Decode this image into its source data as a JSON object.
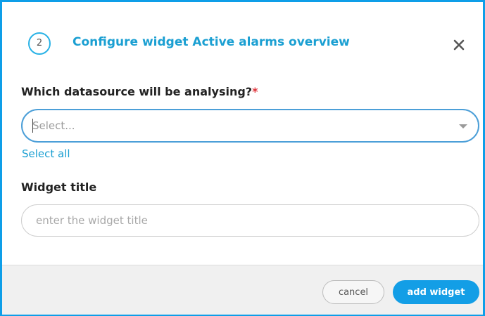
{
  "dialog": {
    "step_number": "2",
    "title": "Configure widget Active alarms overview",
    "close_icon": "close-icon"
  },
  "datasource": {
    "label": "Which datasource will be analysing?",
    "required_marker": "*",
    "placeholder": "Select...",
    "dropdown_icon": "chevron-down-icon",
    "select_all_label": "Select all"
  },
  "widget_title": {
    "label": "Widget title",
    "placeholder": "enter the widget title",
    "value": ""
  },
  "footer": {
    "cancel_label": "cancel",
    "add_label": "add widget"
  },
  "colors": {
    "accent": "#139ee6",
    "title": "#1a9fd2",
    "required": "#e0333a",
    "border_focus": "#4c9fd8"
  }
}
